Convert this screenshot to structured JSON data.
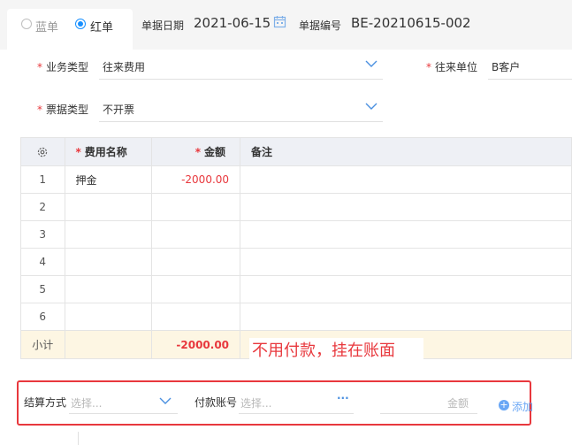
{
  "header": {
    "radio_blue": "蓝单",
    "radio_red": "红单",
    "selected": "red",
    "date_label": "单据日期",
    "date_value": "2021-06-15",
    "number_label": "单据编号",
    "number_value": "BE-20210615-002"
  },
  "form": {
    "business_type_label": "业务类型",
    "business_type_value": "往来费用",
    "partner_label": "往来单位",
    "partner_value": "B客户",
    "invoice_type_label": "票据类型",
    "invoice_type_value": "不开票"
  },
  "table": {
    "headers": {
      "name": "费用名称",
      "amount": "金额",
      "remark": "备注"
    },
    "rows": [
      {
        "index": "1",
        "name": "押金",
        "amount": "-2000.00",
        "remark": ""
      },
      {
        "index": "2",
        "name": "",
        "amount": "",
        "remark": ""
      },
      {
        "index": "3",
        "name": "",
        "amount": "",
        "remark": ""
      },
      {
        "index": "4",
        "name": "",
        "amount": "",
        "remark": ""
      },
      {
        "index": "5",
        "name": "",
        "amount": "",
        "remark": ""
      },
      {
        "index": "6",
        "name": "",
        "amount": "",
        "remark": ""
      }
    ],
    "subtotal_label": "小计",
    "subtotal_amount": "-2000.00"
  },
  "annotation": "不用付款，挂在账面",
  "payment": {
    "method_label": "结算方式",
    "method_placeholder": "选择...",
    "account_label": "付款账号",
    "account_placeholder": "选择...",
    "more": "···",
    "amount_placeholder": "金额",
    "add_label": "添加"
  },
  "colors": {
    "accent": "#1890ff",
    "required": "#e8383d",
    "highlight_box": "#e8383d",
    "subtotal_bg": "#fdf6e3"
  }
}
